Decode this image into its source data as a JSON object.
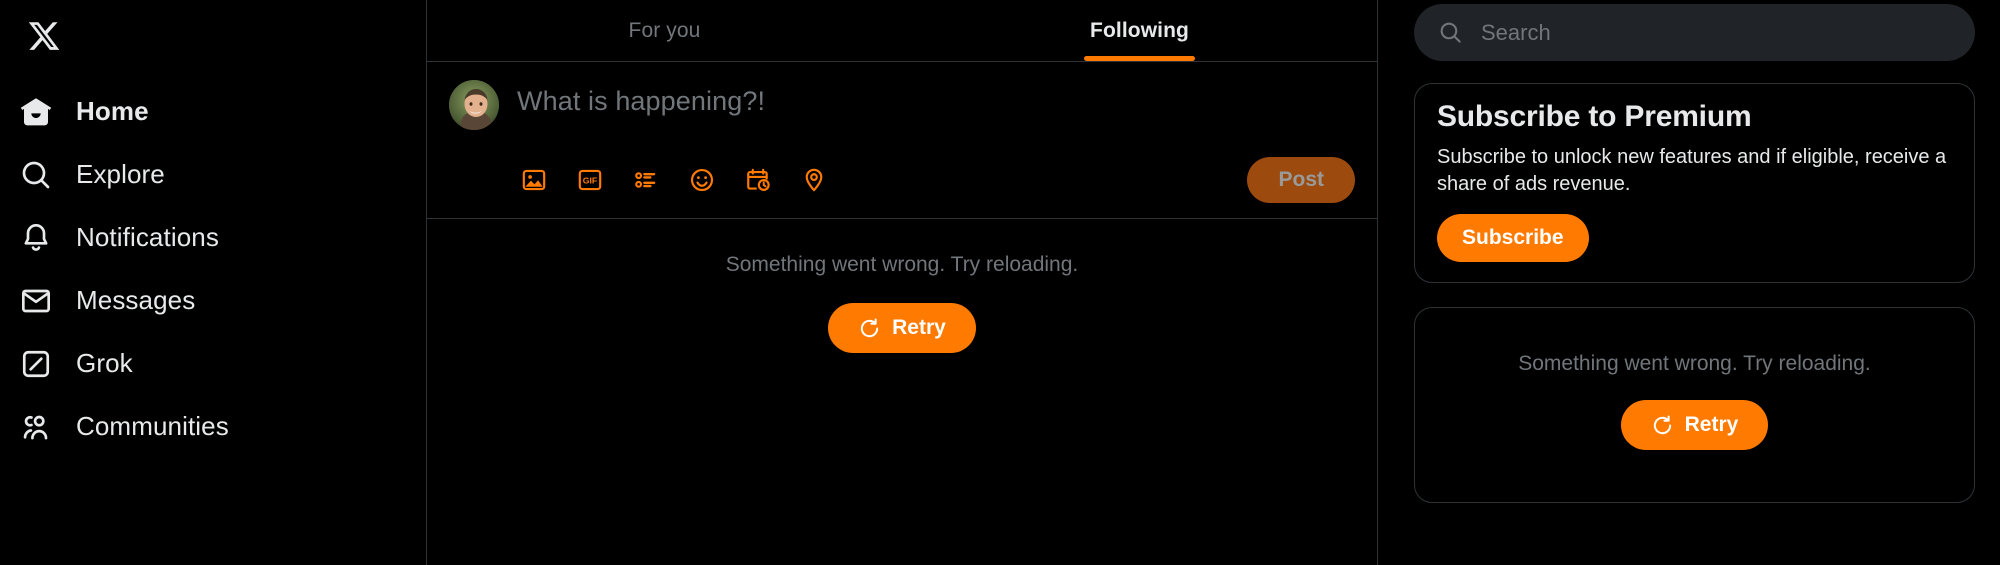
{
  "theme": {
    "background": "#000000",
    "accent": "#ff7a00",
    "accent_muted": "#9c4a0e",
    "text_primary": "#e7e9ea",
    "text_muted": "#71767b",
    "border": "#2f3336",
    "search_bg": "#202327"
  },
  "sidebar": {
    "logo": "x-logo",
    "items": [
      {
        "label": "Home",
        "icon": "home-icon",
        "active": true
      },
      {
        "label": "Explore",
        "icon": "search-icon",
        "active": false
      },
      {
        "label": "Notifications",
        "icon": "bell-icon",
        "active": false
      },
      {
        "label": "Messages",
        "icon": "envelope-icon",
        "active": false
      },
      {
        "label": "Grok",
        "icon": "grok-icon",
        "active": false
      },
      {
        "label": "Communities",
        "icon": "communities-icon",
        "active": false
      }
    ]
  },
  "main": {
    "tabs": [
      {
        "label": "For you",
        "active": false
      },
      {
        "label": "Following",
        "active": true
      }
    ],
    "composer": {
      "avatar": "user-avatar",
      "placeholder": "What is happening?!",
      "actions": [
        {
          "icon": "image-icon"
        },
        {
          "icon": "gif-icon"
        },
        {
          "icon": "poll-icon"
        },
        {
          "icon": "emoji-icon"
        },
        {
          "icon": "schedule-icon"
        },
        {
          "icon": "location-icon"
        }
      ],
      "post_label": "Post",
      "post_disabled": true
    },
    "error": {
      "message": "Something went wrong. Try reloading.",
      "retry_label": "Retry",
      "retry_icon": "refresh-icon"
    }
  },
  "right": {
    "search": {
      "placeholder": "Search",
      "icon": "search-icon",
      "value": ""
    },
    "premium_card": {
      "title": "Subscribe to Premium",
      "body": "Subscribe to unlock new features and if eligible, receive a share of ads revenue.",
      "button_label": "Subscribe"
    },
    "error_card": {
      "message": "Something went wrong. Try reloading.",
      "retry_label": "Retry",
      "retry_icon": "refresh-icon"
    }
  }
}
